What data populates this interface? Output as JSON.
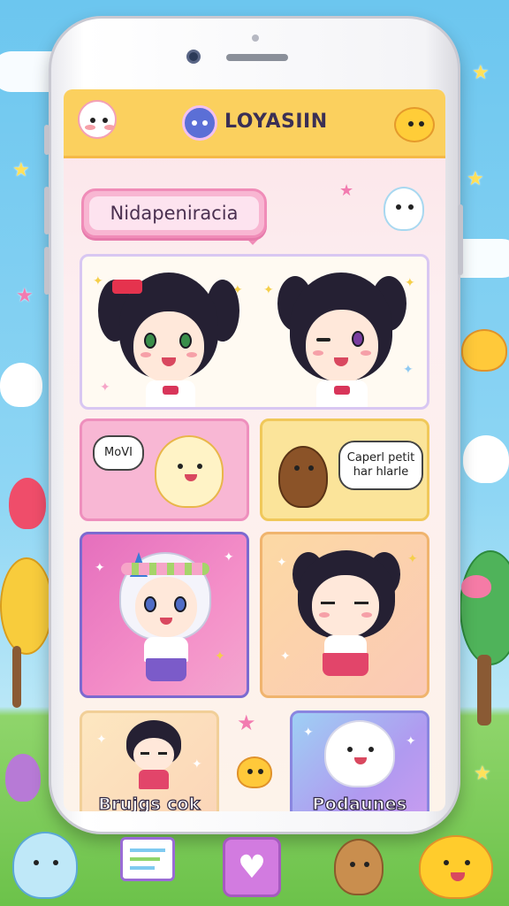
{
  "app": {
    "title": "LOYASIIN",
    "logo_icon": "bird-logo-icon"
  },
  "header": {
    "left_mascot": "cat-mascot-icon",
    "right_mascot": "chick-mascot-icon"
  },
  "tag": {
    "label": "Nidapeniracia"
  },
  "cards": {
    "hero": {
      "left_icon": "anime-girl-icon",
      "right_icon": "winking-anime-girl-icon"
    },
    "card1": {
      "speech": "MoVI",
      "icon": "hamster-icon"
    },
    "card2": {
      "speech": "Caperl petit har hlarle",
      "icon": "bear-icon"
    },
    "card3": {
      "icon": "flower-crown-character-icon"
    },
    "card4": {
      "icon": "sleepy-girl-icon"
    },
    "card5": {
      "label": "Brujgs cok",
      "icon": "chibi-boy-icon"
    },
    "card6": {
      "label": "Podaunes",
      "icon": "white-bear-icon"
    }
  },
  "dock": {
    "left": "board-icon",
    "center": "heart-icon",
    "right": "puppy-icon"
  },
  "colors": {
    "header": "#fbd05e",
    "tag": "#f8b6d2",
    "pink_card": "#f8b7d4",
    "yellow_card": "#fbe49a",
    "purple_card": "#b09af0"
  }
}
